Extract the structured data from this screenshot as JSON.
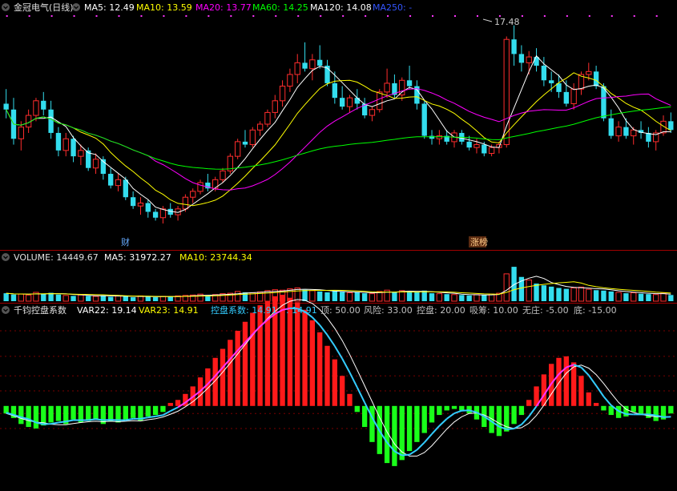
{
  "main_panel": {
    "stock_name": "金冠电气(日线)",
    "ma": [
      {
        "label": "MA5: 12.49",
        "color": "#ffffff"
      },
      {
        "label": "MA10: 13.59",
        "color": "#ffff00"
      },
      {
        "label": "MA20: 13.77",
        "color": "#ff00ff"
      },
      {
        "label": "MA60: 14.25",
        "color": "#00ff00"
      },
      {
        "label": "MA120: 14.08",
        "color": "#ffffff"
      },
      {
        "label": "MA250: -",
        "color": "#3355ff"
      }
    ],
    "high_marker": "17.48",
    "event_tags": [
      {
        "text": "财",
        "color": "#66aaff"
      },
      {
        "text": "涨榜",
        "color": "#ffcc88"
      }
    ]
  },
  "volume_panel": {
    "title": "VOLUME: 14449.67",
    "ma5": "MA5: 31972.27",
    "ma10": "MA10: 23744.34"
  },
  "indicator_panel": {
    "name": "千钧控盘系数",
    "items": [
      {
        "label": "VAR22: 19.14",
        "color": "#ffffff"
      },
      {
        "label": "VAR23: 14.91",
        "color": "#ffff00"
      },
      {
        "label": "控盘系数: 14.91",
        "color": "#33ccff"
      },
      {
        "label": ": 14.91",
        "color": "#33ccff"
      },
      {
        "label": "顶: 50.00",
        "color": "#c0c0c0"
      },
      {
        "label": "风险: 33.00",
        "color": "#c0c0c0"
      },
      {
        "label": "控盘: 20.00",
        "color": "#c0c0c0"
      },
      {
        "label": "吸筹: 10.00",
        "color": "#c0c0c0"
      },
      {
        "label": "无庄: -5.00",
        "color": "#c0c0c0"
      },
      {
        "label": "底: -15.00",
        "color": "#c0c0c0"
      }
    ]
  },
  "chart_data": [
    {
      "type": "candlestick",
      "title": "金冠电气(日线)",
      "colors": {
        "up": "#ff2d2d",
        "down": "#33ddee"
      },
      "ohlc": [
        [
          14.8,
          15.3,
          14.3,
          14.6
        ],
        [
          14.6,
          15.0,
          13.4,
          13.6
        ],
        [
          13.6,
          14.2,
          13.2,
          14.0
        ],
        [
          14.0,
          14.6,
          13.8,
          14.4
        ],
        [
          14.4,
          15.0,
          14.2,
          14.9
        ],
        [
          14.9,
          15.2,
          14.4,
          14.6
        ],
        [
          14.6,
          14.9,
          13.6,
          13.8
        ],
        [
          13.8,
          14.0,
          13.0,
          13.2
        ],
        [
          13.2,
          13.8,
          13.0,
          13.6
        ],
        [
          13.6,
          13.7,
          12.8,
          13.0
        ],
        [
          13.0,
          13.4,
          12.7,
          13.2
        ],
        [
          13.2,
          13.3,
          12.5,
          12.6
        ],
        [
          12.6,
          13.1,
          12.4,
          12.9
        ],
        [
          12.9,
          13.0,
          12.2,
          12.4
        ],
        [
          12.4,
          12.6,
          11.9,
          12.0
        ],
        [
          12.0,
          12.4,
          11.8,
          12.2
        ],
        [
          12.2,
          12.3,
          11.5,
          11.6
        ],
        [
          11.6,
          11.8,
          11.2,
          11.3
        ],
        [
          11.3,
          11.6,
          11.0,
          11.4
        ],
        [
          11.4,
          11.5,
          10.9,
          11.1
        ],
        [
          11.1,
          11.2,
          10.8,
          10.9
        ],
        [
          10.9,
          11.3,
          10.7,
          11.2
        ],
        [
          11.2,
          11.4,
          10.9,
          11.0
        ],
        [
          11.0,
          11.3,
          10.8,
          11.2
        ],
        [
          11.2,
          11.7,
          11.1,
          11.6
        ],
        [
          11.6,
          11.9,
          11.4,
          11.8
        ],
        [
          11.8,
          12.2,
          11.7,
          12.1
        ],
        [
          12.1,
          12.4,
          11.8,
          11.9
        ],
        [
          11.9,
          12.3,
          11.8,
          12.2
        ],
        [
          12.2,
          12.6,
          12.1,
          12.5
        ],
        [
          12.5,
          13.1,
          12.4,
          13.0
        ],
        [
          13.0,
          13.6,
          12.9,
          13.5
        ],
        [
          13.5,
          13.9,
          13.3,
          13.4
        ],
        [
          13.4,
          14.0,
          13.3,
          13.9
        ],
        [
          13.9,
          14.2,
          13.7,
          14.1
        ],
        [
          14.1,
          14.6,
          14.0,
          14.5
        ],
        [
          14.5,
          15.1,
          14.3,
          14.9
        ],
        [
          14.9,
          15.6,
          14.7,
          15.4
        ],
        [
          15.4,
          16.0,
          15.2,
          15.8
        ],
        [
          15.8,
          16.5,
          15.5,
          16.2
        ],
        [
          16.2,
          16.9,
          15.9,
          16.0
        ],
        [
          16.0,
          16.5,
          15.6,
          16.3
        ],
        [
          16.3,
          16.8,
          16.0,
          16.1
        ],
        [
          16.1,
          16.3,
          15.4,
          15.5
        ],
        [
          15.5,
          15.9,
          14.8,
          15.0
        ],
        [
          15.0,
          15.4,
          14.6,
          14.7
        ],
        [
          14.7,
          15.1,
          14.5,
          15.0
        ],
        [
          15.0,
          15.3,
          14.6,
          14.8
        ],
        [
          14.8,
          15.0,
          14.3,
          14.4
        ],
        [
          14.4,
          14.7,
          14.2,
          14.6
        ],
        [
          14.6,
          15.3,
          14.5,
          15.2
        ],
        [
          15.2,
          16.0,
          15.0,
          15.5
        ],
        [
          15.5,
          15.8,
          15.0,
          15.1
        ],
        [
          15.1,
          15.7,
          14.9,
          15.6
        ],
        [
          15.6,
          16.1,
          15.3,
          15.4
        ],
        [
          15.4,
          15.6,
          14.6,
          14.8
        ],
        [
          14.8,
          14.9,
          13.6,
          13.7
        ],
        [
          13.7,
          13.9,
          13.4,
          13.6
        ],
        [
          13.6,
          13.9,
          13.4,
          13.7
        ],
        [
          13.7,
          13.9,
          13.4,
          13.5
        ],
        [
          13.5,
          13.9,
          13.3,
          13.8
        ],
        [
          13.8,
          13.9,
          13.4,
          13.5
        ],
        [
          13.5,
          13.7,
          13.2,
          13.3
        ],
        [
          13.3,
          13.6,
          13.1,
          13.4
        ],
        [
          13.4,
          13.5,
          13.0,
          13.1
        ],
        [
          13.1,
          13.4,
          13.0,
          13.3
        ],
        [
          13.3,
          13.5,
          13.1,
          13.4
        ],
        [
          13.4,
          17.1,
          13.3,
          17.0
        ],
        [
          17.0,
          17.48,
          16.1,
          16.5
        ],
        [
          16.5,
          16.8,
          15.9,
          16.2
        ],
        [
          16.2,
          16.6,
          15.8,
          16.4
        ],
        [
          16.4,
          16.7,
          15.9,
          16.1
        ],
        [
          16.1,
          16.4,
          15.4,
          15.6
        ],
        [
          15.6,
          15.9,
          15.2,
          15.5
        ],
        [
          15.5,
          15.8,
          15.0,
          15.2
        ],
        [
          15.2,
          15.6,
          14.7,
          14.8
        ],
        [
          14.8,
          15.5,
          14.6,
          15.3
        ],
        [
          15.3,
          15.9,
          15.1,
          15.8
        ],
        [
          15.8,
          16.2,
          15.6,
          15.9
        ],
        [
          15.9,
          16.1,
          15.3,
          15.4
        ],
        [
          15.4,
          15.5,
          14.2,
          14.3
        ],
        [
          14.3,
          14.6,
          13.6,
          13.7
        ],
        [
          13.7,
          14.2,
          13.5,
          14.0
        ],
        [
          14.0,
          14.3,
          13.6,
          13.7
        ],
        [
          13.7,
          14.0,
          13.4,
          13.9
        ],
        [
          13.9,
          14.2,
          13.6,
          13.8
        ],
        [
          13.8,
          14.0,
          13.3,
          13.5
        ],
        [
          13.5,
          13.9,
          13.2,
          13.8
        ],
        [
          13.8,
          14.4,
          13.7,
          14.2
        ],
        [
          14.2,
          14.5,
          13.8,
          13.9
        ]
      ]
    },
    {
      "type": "bar",
      "title": "VOLUME",
      "values": [
        18,
        15,
        16,
        14,
        20,
        17,
        19,
        15,
        13,
        12,
        14,
        12,
        11,
        13,
        10,
        12,
        11,
        9,
        12,
        10,
        9,
        11,
        10,
        12,
        13,
        14,
        16,
        12,
        15,
        17,
        18,
        22,
        20,
        19,
        21,
        24,
        26,
        25,
        28,
        30,
        26,
        24,
        22,
        20,
        23,
        21,
        19,
        20,
        18,
        17,
        22,
        25,
        21,
        24,
        22,
        20,
        24,
        18,
        17,
        16,
        15,
        14,
        13,
        15,
        14,
        16,
        18,
        62,
        78,
        55,
        48,
        40,
        36,
        33,
        30,
        28,
        30,
        32,
        27,
        25,
        24,
        22,
        20,
        18,
        19,
        17,
        16,
        15,
        18,
        14
      ],
      "ylim": [
        0,
        80
      ]
    },
    {
      "type": "bar",
      "title": "千钧控盘系数",
      "values": [
        -5,
        -8,
        -12,
        -14,
        -15,
        -13,
        -11,
        -10,
        -12,
        -9,
        -11,
        -10,
        -9,
        -12,
        -10,
        -11,
        -9,
        -8,
        -10,
        -7,
        -6,
        -4,
        2,
        4,
        8,
        13,
        19,
        25,
        32,
        38,
        44,
        50,
        56,
        62,
        67,
        70,
        73,
        74,
        72,
        69,
        64,
        57,
        49,
        40,
        31,
        20,
        8,
        -4,
        -14,
        -24,
        -32,
        -38,
        -40,
        -36,
        -30,
        -24,
        -18,
        -11,
        -6,
        -3,
        -2,
        -3,
        -5,
        -9,
        -14,
        -18,
        -20,
        -17,
        -12,
        -6,
        4,
        13,
        21,
        28,
        32,
        33,
        29,
        20,
        9,
        2,
        -3,
        -6,
        -8,
        -7,
        -4,
        -6,
        -8,
        -10,
        -9,
        -5
      ],
      "series": [
        {
          "name": "VAR22",
          "color": "#ffffff"
        },
        {
          "name": "VAR23",
          "color": "#ffff00"
        },
        {
          "name": "控盘系数",
          "color": "#33ccff"
        }
      ],
      "levels": {
        "顶": 50,
        "风险": 33,
        "控盘": 20,
        "吸筹": 10,
        "无庄": -5,
        "底": -15
      },
      "ylim": [
        -55,
        58
      ]
    }
  ]
}
